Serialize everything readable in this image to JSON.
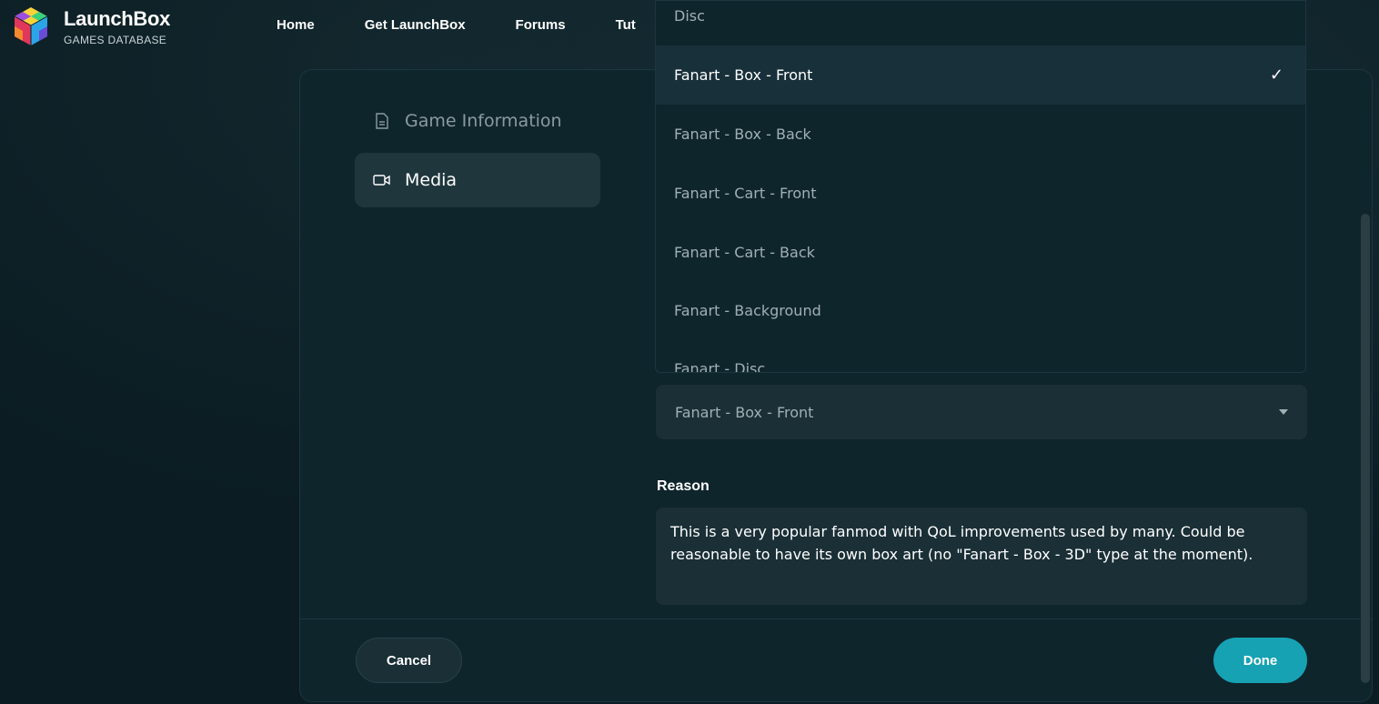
{
  "brand": {
    "title": "LaunchBox",
    "subtitle": "GAMES DATABASE"
  },
  "nav": {
    "items": [
      "Home",
      "Get LaunchBox",
      "Forums",
      "Tut"
    ]
  },
  "sidebar": {
    "items": [
      {
        "label": "Game Information",
        "icon": "document-icon"
      },
      {
        "label": "Media",
        "icon": "video-camera-icon"
      }
    ]
  },
  "media_type": {
    "selected_value": "Fanart - Box - Front",
    "options": [
      "Disc",
      "Fanart - Box - Front",
      "Fanart - Box - Back",
      "Fanart - Cart - Front",
      "Fanart - Cart - Back",
      "Fanart - Background",
      "Fanart - Disc"
    ],
    "selected_index": 1,
    "check_mark": "✓"
  },
  "reason": {
    "label": "Reason",
    "value": "This is a very popular fanmod with QoL improvements used by many. Could be reasonable to have its own box art (no \"Fanart - Box - 3D\" type at the moment)."
  },
  "footer": {
    "cancel_label": "Cancel",
    "done_label": "Done"
  },
  "colors": {
    "background": "#0b1d23",
    "dialog": "#0f252c",
    "accent": "#17a2b4"
  }
}
